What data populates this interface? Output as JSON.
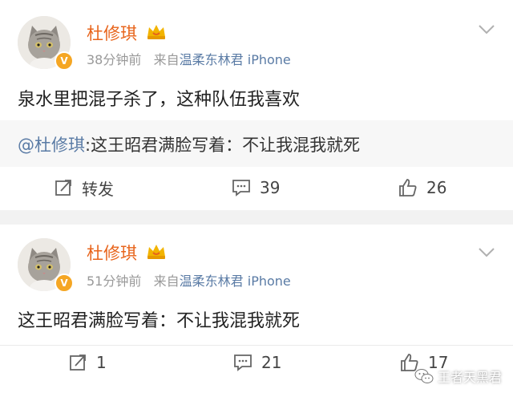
{
  "posts": [
    {
      "username": "杜修琪",
      "time": "38分钟前",
      "source_prefix": "来自",
      "source_name": "温柔东林君 iPhone",
      "content": "泉水里把混子杀了，这种队伍我喜欢",
      "repost": {
        "mention": "@杜修琪",
        "text": ":这王昭君满脸写着：不让我混我就死"
      },
      "actions": {
        "forward": "转发",
        "comments": "39",
        "likes": "26"
      }
    },
    {
      "username": "杜修琪",
      "time": "51分钟前",
      "source_prefix": "来自",
      "source_name": "温柔东林君 iPhone",
      "content": "这王昭君满脸写着：不让我混我就死",
      "actions": {
        "forward": "1",
        "comments": "21",
        "likes": "17"
      }
    }
  ],
  "watermark": "王者天黑君",
  "colors": {
    "username": "#e8641b",
    "link": "#5a7ba5",
    "background": "#f2f2f2"
  }
}
